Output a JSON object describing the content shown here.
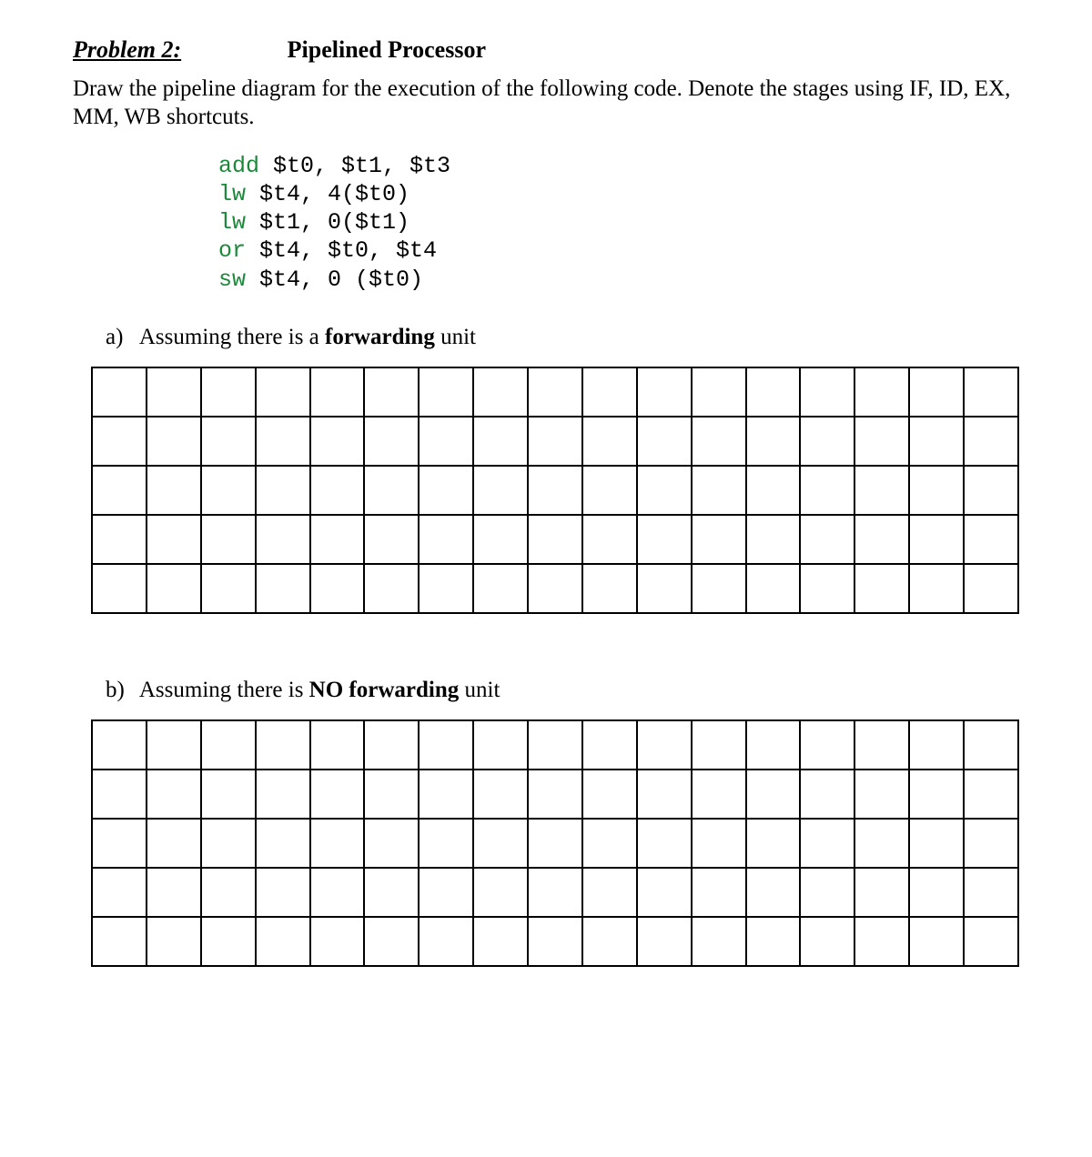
{
  "header": {
    "problem_label": "Problem 2:",
    "problem_title": "Pipelined Processor"
  },
  "instructions": "Draw the pipeline diagram for the execution of the following code. Denote the stages using IF, ID, EX, MM, WB shortcuts.",
  "code": [
    {
      "op": "add",
      "rest": " $t0, $t1, $t3"
    },
    {
      "op": "lw",
      "rest": " $t4, 4($t0)"
    },
    {
      "op": "lw",
      "rest": " $t1, 0($t1)"
    },
    {
      "op": "or",
      "rest": " $t4, $t0, $t4"
    },
    {
      "op": "sw",
      "rest": " $t4, 0 ($t0)"
    }
  ],
  "parts": {
    "a": {
      "letter": "a)",
      "text_before": "Assuming there is a ",
      "bold": "forwarding",
      "text_after": " unit",
      "grid": {
        "rows": 5,
        "cols": 17
      }
    },
    "b": {
      "letter": "b)",
      "text_before": "Assuming there is ",
      "bold": "NO forwarding",
      "text_after": " unit",
      "grid": {
        "rows": 5,
        "cols": 17
      }
    }
  }
}
